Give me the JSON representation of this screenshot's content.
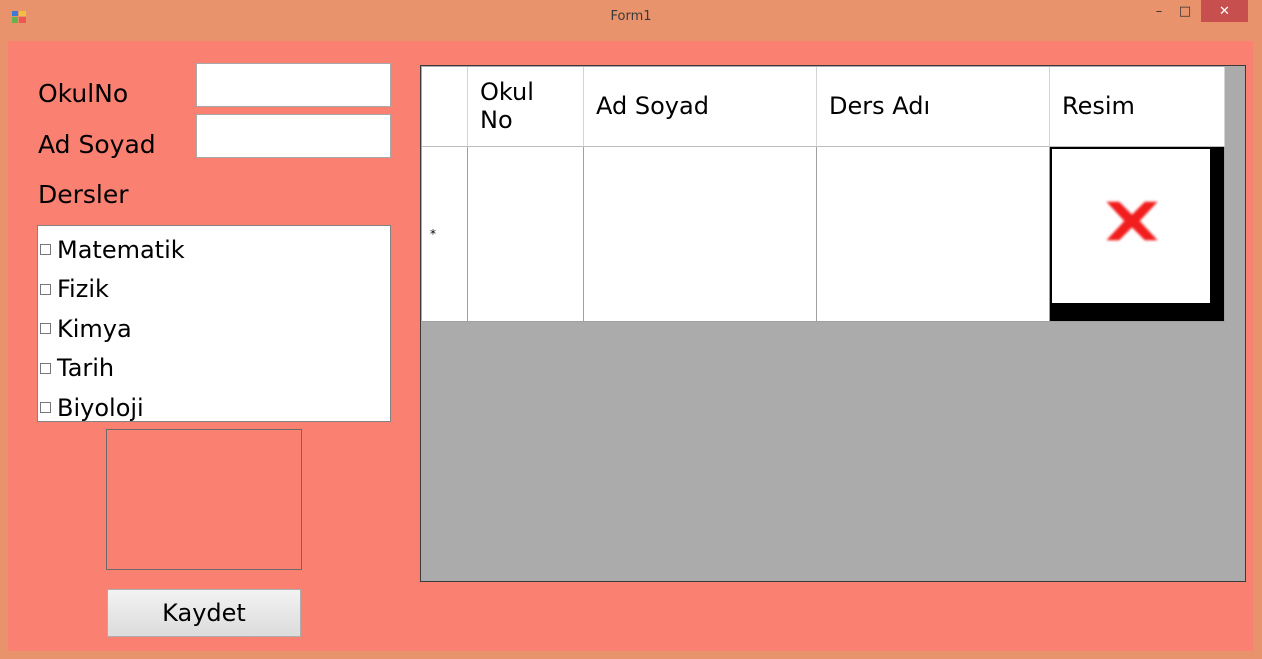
{
  "window": {
    "title": "Form1"
  },
  "titlebar": {
    "minimize": "–",
    "maximize": "□",
    "close": "✕"
  },
  "form": {
    "okulno_label": "OkulNo",
    "okulno_value": "",
    "adsoyad_label": "Ad Soyad",
    "adsoyad_value": "",
    "dersler_label": "Dersler",
    "dersler_items": [
      "Matematik",
      "Fizik",
      "Kimya",
      "Tarih",
      "Biyoloji"
    ],
    "save_button": "Kaydet"
  },
  "grid": {
    "columns": [
      "Okul\nNo",
      "Ad Soyad",
      "Ders Adı",
      "Resim"
    ],
    "new_row_marker": "*",
    "rows": [
      {
        "okul_no": "",
        "ad_soyad": "",
        "ders_adi": "",
        "resim": "broken-image-icon"
      }
    ]
  },
  "colors": {
    "form_background": "#fa8072",
    "grid_background": "#ababab",
    "titlebar": "#e8936b",
    "close_button": "#c7504f"
  }
}
